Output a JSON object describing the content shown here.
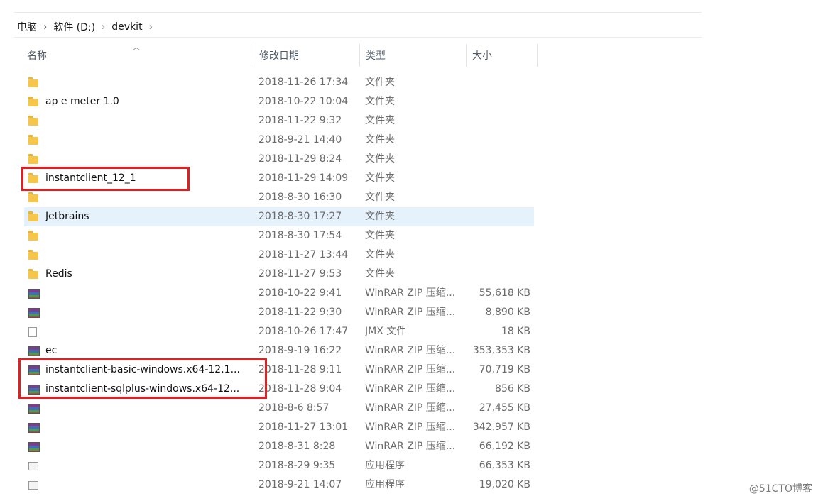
{
  "breadcrumb": {
    "items": [
      "电脑",
      "软件 (D:)",
      "devkit"
    ],
    "separator": "›"
  },
  "columns": {
    "name": "名称",
    "modified": "修改日期",
    "type": "类型",
    "size": "大小"
  },
  "rows": [
    {
      "icon": "folder-icon",
      "name": "",
      "date": "2018-11-26 17:34",
      "type": "文件夹",
      "size": ""
    },
    {
      "icon": "folder-icon",
      "name": "ap  e  meter 1.0",
      "date": "2018-10-22 10:04",
      "type": "文件夹",
      "size": ""
    },
    {
      "icon": "folder-icon",
      "name": "",
      "date": "2018-11-22 9:32",
      "type": "文件夹",
      "size": ""
    },
    {
      "icon": "folder-icon",
      "name": "",
      "date": "2018-9-21 14:40",
      "type": "文件夹",
      "size": ""
    },
    {
      "icon": "folder-icon",
      "name": "",
      "date": "2018-11-29 8:24",
      "type": "文件夹",
      "size": ""
    },
    {
      "icon": "folder-icon",
      "name": "instantclient_12_1",
      "date": "2018-11-29 14:09",
      "type": "文件夹",
      "size": ""
    },
    {
      "icon": "folder-icon",
      "name": "",
      "date": "2018-8-30 16:30",
      "type": "文件夹",
      "size": ""
    },
    {
      "icon": "folder-icon",
      "name": "Jetbrains",
      "date": "2018-8-30 17:27",
      "type": "文件夹",
      "size": "",
      "selected": true
    },
    {
      "icon": "folder-icon",
      "name": "",
      "date": "2018-8-30 17:54",
      "type": "文件夹",
      "size": ""
    },
    {
      "icon": "folder-icon",
      "name": "",
      "date": "2018-11-27 13:44",
      "type": "文件夹",
      "size": ""
    },
    {
      "icon": "folder-icon",
      "name": "Redis",
      "date": "2018-11-27 9:53",
      "type": "文件夹",
      "size": ""
    },
    {
      "icon": "archive-icon",
      "name": "",
      "date": "2018-10-22 9:41",
      "type": "WinRAR ZIP 压缩...",
      "size": "55,618 KB"
    },
    {
      "icon": "archive-icon",
      "name": "",
      "date": "2018-11-22 9:30",
      "type": "WinRAR ZIP 压缩...",
      "size": "8,890 KB"
    },
    {
      "icon": "file-icon",
      "name": "",
      "date": "2018-10-26 17:47",
      "type": "JMX 文件",
      "size": "18 KB"
    },
    {
      "icon": "archive-icon",
      "name": "ec",
      "date": "2018-9-19 16:22",
      "type": "WinRAR ZIP 压缩...",
      "size": "353,353 KB"
    },
    {
      "icon": "archive-icon",
      "name": "instantclient-basic-windows.x64-12.1...",
      "date": "2018-11-28 9:11",
      "type": "WinRAR ZIP 压缩...",
      "size": "70,719 KB"
    },
    {
      "icon": "archive-icon",
      "name": "instantclient-sqlplus-windows.x64-12...",
      "date": "2018-11-28 9:04",
      "type": "WinRAR ZIP 压缩...",
      "size": "856 KB"
    },
    {
      "icon": "archive-icon",
      "name": "",
      "date": "2018-8-6 8:57",
      "type": "WinRAR ZIP 压缩...",
      "size": "27,455 KB"
    },
    {
      "icon": "archive-icon",
      "name": "",
      "date": "2018-11-27 13:01",
      "type": "WinRAR ZIP 压缩...",
      "size": "342,957 KB"
    },
    {
      "icon": "archive-icon",
      "name": "",
      "date": "2018-8-31 8:28",
      "type": "WinRAR ZIP 压缩...",
      "size": "66,192 KB"
    },
    {
      "icon": "app-icon",
      "name": "",
      "date": "2018-8-29 9:35",
      "type": "应用程序",
      "size": "66,353 KB"
    },
    {
      "icon": "app-icon",
      "name": "",
      "date": "2018-9-21 14:07",
      "type": "应用程序",
      "size": "19,020 KB"
    }
  ],
  "highlight_color": "#e02020",
  "selection_color": "#e5f1fb",
  "watermark": "@51CTO博客"
}
